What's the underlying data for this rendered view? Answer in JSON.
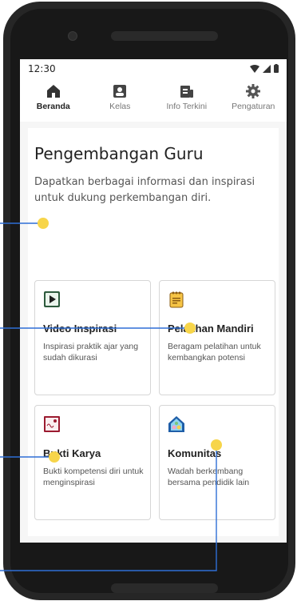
{
  "status": {
    "time": "12:30"
  },
  "tabs": [
    {
      "label": "Beranda",
      "icon": "home-icon",
      "active": true
    },
    {
      "label": "Kelas",
      "icon": "class-icon",
      "active": false
    },
    {
      "label": "Info Terkini",
      "icon": "news-icon",
      "active": false
    },
    {
      "label": "Pengaturan",
      "icon": "gear-icon",
      "active": false
    }
  ],
  "main": {
    "title": "Pengembangan Guru",
    "subtitle": "Dapatkan berbagai informasi dan inspirasi untuk dukung perkembangan diri."
  },
  "cards": [
    {
      "title": "Video Inspirasi",
      "description": "Inspirasi praktik ajar yang sudah dikurasi",
      "icon": "video-play-icon"
    },
    {
      "title": "Pelatihan Mandiri",
      "description": "Beragam pelatihan untuk kembangkan potensi",
      "icon": "notepad-icon"
    },
    {
      "title": "Bukti Karya",
      "description": "Bukti kompetensi diri untuk menginspirasi",
      "icon": "certificate-icon"
    },
    {
      "title": "Komunitas",
      "description": "Wadah berkembang bersama pendidik lain",
      "icon": "community-house-icon"
    }
  ],
  "colors": {
    "accent": "#f7d54a",
    "callout_line": "#2f6fd6",
    "phone_body": "#262626"
  }
}
